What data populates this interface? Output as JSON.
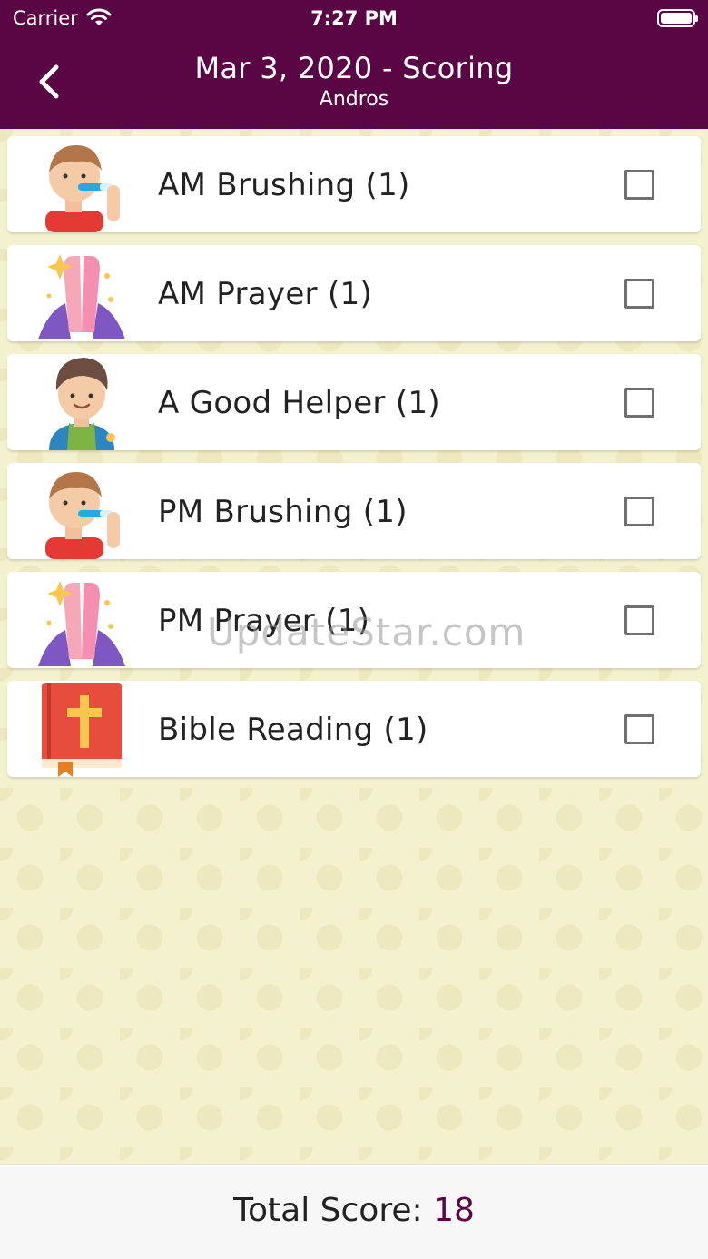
{
  "status_bar": {
    "carrier": "Carrier",
    "time": "7:27 PM"
  },
  "header": {
    "title": "Mar 3, 2020 - Scoring",
    "subtitle": "Andros",
    "back_icon": "chevron-left-icon"
  },
  "tasks": [
    {
      "label": "AM Brushing (1)",
      "icon": "boy-brushing-teeth-icon",
      "checked": false
    },
    {
      "label": "AM Prayer (1)",
      "icon": "praying-hands-icon",
      "checked": false
    },
    {
      "label": "A Good Helper (1)",
      "icon": "boy-helper-icon",
      "checked": false
    },
    {
      "label": "PM Brushing (1)",
      "icon": "boy-brushing-teeth-icon",
      "checked": false
    },
    {
      "label": "PM Prayer (1)",
      "icon": "praying-hands-icon",
      "checked": false
    },
    {
      "label": "Bible Reading (1)",
      "icon": "bible-book-icon",
      "checked": false
    }
  ],
  "watermark": "UpdateStar.com",
  "footer": {
    "label": "Total Score:",
    "value": "18"
  },
  "colors": {
    "header_bg": "#5a0645",
    "background": "#f4f1cf",
    "score_value": "#5a0645"
  }
}
